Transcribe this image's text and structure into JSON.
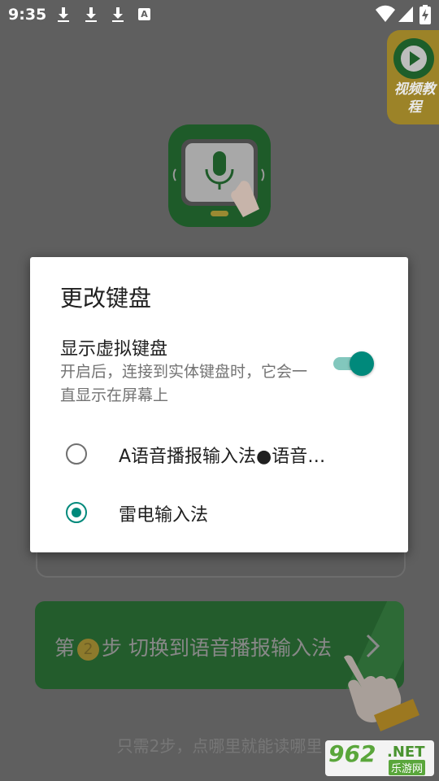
{
  "status_bar": {
    "time": "9:35",
    "keyboard_badge": "A"
  },
  "video_tutorial": {
    "label": "视频教程"
  },
  "dialog": {
    "title": "更改键盘",
    "toggle": {
      "title": "显示虚拟键盘",
      "summary": "开启后，连接到实体键盘时，它会一直显示在屏幕上",
      "enabled": true
    },
    "input_methods": [
      {
        "label": "A语音播报输入法●语音…",
        "selected": false
      },
      {
        "label": "雷电输入法",
        "selected": true
      }
    ]
  },
  "step": {
    "prefix": "第",
    "number": "2",
    "middle": "步",
    "action": "切换到语音播报输入法"
  },
  "hint": "只需2步，点哪里就能读哪里",
  "watermark": {
    "number": "962",
    "domain": ".NET",
    "site": "乐游网"
  },
  "colors": {
    "accent": "#00897b",
    "brand_green": "#1e7a32",
    "scrim": "#5f5f5f"
  }
}
